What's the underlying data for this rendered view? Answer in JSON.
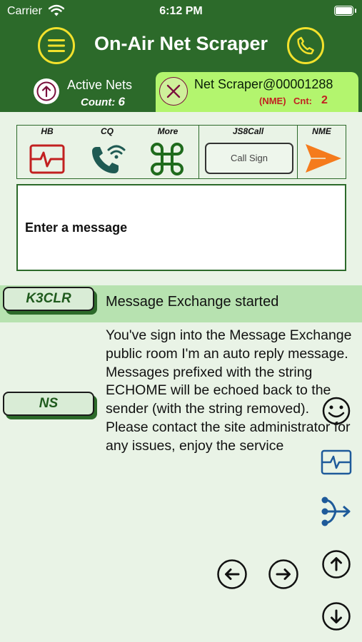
{
  "status_bar": {
    "carrier": "Carrier",
    "time": "6:12 PM"
  },
  "header": {
    "title": "On-Air Net Scraper"
  },
  "tabs": {
    "active": {
      "label": "Active Nets",
      "count_label": "Count:",
      "count": "6"
    },
    "scraper": {
      "label": "Net Scraper@00001288",
      "nme": "(NME)",
      "cnt_label": "Cnt:",
      "cnt": "2"
    }
  },
  "toolbar": {
    "hb": "HB",
    "cq": "CQ",
    "more": "More",
    "js8call": "JS8Call",
    "nme": "NME",
    "callsign_placeholder": "Call Sign"
  },
  "message_input": {
    "placeholder": "Enter a message"
  },
  "messages": [
    {
      "sender": "K3CLR",
      "text": "Message Exchange started"
    },
    {
      "sender": "NS",
      "text": "You've sign into the Message Exchange public room I'm an auto reply message. Messages prefixed with the string ECHOME will be echoed back to the sender (with the string removed). Please contact the site administrator for any issues, enjoy the service"
    }
  ],
  "colors": {
    "header_green": "#2c6a2a",
    "accent_yellow": "#f2e12c",
    "tab_active": "#b3f56e",
    "red": "#c22020",
    "orange": "#f57b1c"
  }
}
